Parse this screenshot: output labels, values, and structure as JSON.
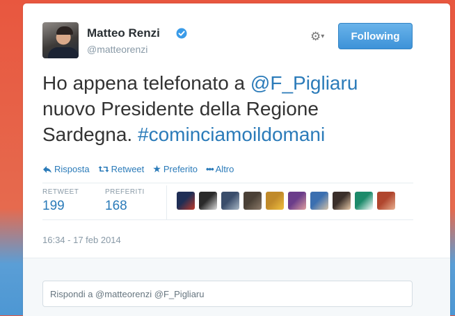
{
  "user": {
    "name": "Matteo Renzi",
    "handle": "@matteorenzi",
    "verified": true
  },
  "follow_button": {
    "label": "Following"
  },
  "tweet": {
    "parts": [
      {
        "text": "Ho appena telefonato a ",
        "link": false
      },
      {
        "text": "@F_Pigliaru",
        "link": true
      },
      {
        "text": " nuovo Presidente della Regione Sardegna. ",
        "link": false
      },
      {
        "text": "#cominciamoildomani",
        "link": true
      }
    ]
  },
  "actions": {
    "reply": "Risposta",
    "retweet": "Retweet",
    "favorite": "Preferito",
    "more": "Altro"
  },
  "stats": {
    "retweets_label": "RETWEET",
    "retweets_value": "199",
    "favorites_label": "PREFERITI",
    "favorites_value": "168"
  },
  "favoriters": [
    {
      "colors": [
        "#1f2e55",
        "#c13a2a"
      ]
    },
    {
      "colors": [
        "#2a2a2a",
        "#dddddd"
      ]
    },
    {
      "colors": [
        "#3a4d6b",
        "#a9b8c6"
      ]
    },
    {
      "colors": [
        "#4a4036",
        "#8c7b6a"
      ]
    },
    {
      "colors": [
        "#c08a2a",
        "#f0c040"
      ]
    },
    {
      "colors": [
        "#6b3d8a",
        "#e0a0a0"
      ]
    },
    {
      "colors": [
        "#3b6fb0",
        "#d6c3a8"
      ]
    },
    {
      "colors": [
        "#3a2f2a",
        "#e8c9a8"
      ]
    },
    {
      "colors": [
        "#1c8a6a",
        "#ffffff"
      ]
    },
    {
      "colors": [
        "#b0462e",
        "#e8b090"
      ]
    }
  ],
  "timestamp": "16:34 - 17 feb 2014",
  "reply": {
    "placeholder": "Rispondi a @matteorenzi @F_Pigliaru"
  },
  "colors": {
    "accent": "#2b7bb9",
    "follow_button": "#4a9ee0"
  }
}
